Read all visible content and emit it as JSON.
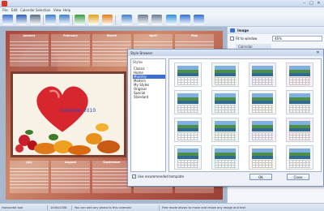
{
  "window": {
    "title": "",
    "controls": [
      "–",
      "□",
      "✕"
    ]
  },
  "menu": [
    "File",
    "Edit",
    "Calendar",
    "Selection",
    "View",
    "Help"
  ],
  "toolbar": {
    "buttons": [
      {
        "icon": "new-icon",
        "color": "#3b6fd0"
      },
      {
        "icon": "save-icon",
        "color": "#2b5fb3"
      },
      {
        "icon": "print-icon",
        "color": "#5a6c86"
      },
      {
        "icon": "undo-icon",
        "color": "#3d7cc9"
      },
      {
        "icon": "redo-icon",
        "color": "#3d7cc9"
      },
      {
        "icon": "image-icon",
        "color": "#3a9a3f"
      },
      {
        "icon": "text-icon",
        "color": "#e0a21a"
      },
      {
        "icon": "shape-icon",
        "color": "#e07b1a"
      },
      {
        "icon": "layout-icon",
        "color": "#3e7fc7"
      },
      {
        "icon": "grid-icon",
        "color": "#6b7b92"
      },
      {
        "icon": "move-icon",
        "color": "#6b7b92"
      },
      {
        "icon": "zoom-icon",
        "color": "#2e8fd6"
      },
      {
        "icon": "help-icon",
        "color": "#2f6fd1"
      },
      {
        "icon": "about-icon",
        "color": "#2f6fd1"
      }
    ]
  },
  "canvas": {
    "photo_caption": "Calendar 2010",
    "months_top": [
      "January",
      "February",
      "March",
      "April",
      "May",
      "June"
    ],
    "months_bottom": [
      "July",
      "August",
      "September",
      "October",
      "November",
      "December"
    ]
  },
  "right_panel": {
    "title": "Image",
    "fit_label": "Fit to window",
    "fit_checked": true,
    "zoom_value": "46%",
    "tab_label": "Calendar"
  },
  "style_dialog": {
    "title": "Style Browser",
    "close": "✕",
    "list_header": "Styles",
    "styles": [
      "Classic",
      "Home",
      "Monthly",
      "Modern",
      "My Styles",
      "Original",
      "Special",
      "Standard"
    ],
    "selected_index": 2,
    "thumbnails": 16,
    "recommended_label": "Use recommended template",
    "recommended_checked": true,
    "ok_label": "OK",
    "cancel_label": "Close"
  },
  "status": {
    "mode": "Horizontal tool",
    "size": "1440x1008",
    "hint_left": "You can add any photo to this calendar",
    "hint_right": "Free mode allows to move and resize any image and text"
  }
}
